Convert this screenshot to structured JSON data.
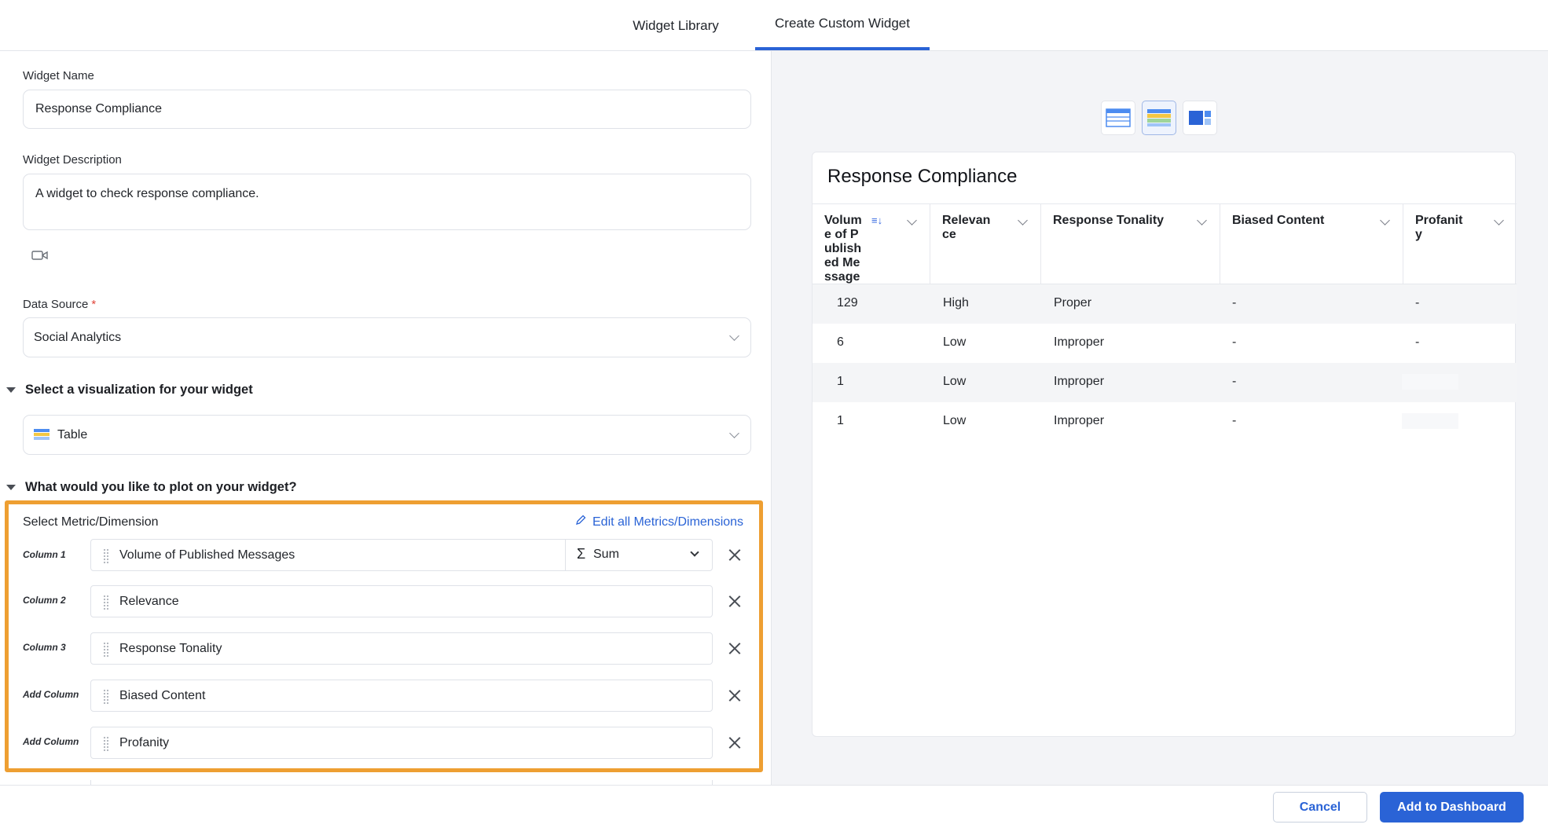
{
  "tabs": {
    "library": "Widget Library",
    "custom": "Create Custom Widget"
  },
  "form": {
    "name_label": "Widget Name",
    "name_value": "Response Compliance",
    "desc_label": "Widget Description",
    "desc_value": "A widget to check response compliance.",
    "source_label": "Data Source",
    "source_required": "*",
    "source_value": "Social Analytics",
    "viz_section": "Select a visualization for your widget",
    "viz_value": "Table",
    "plot_section": "What would you like to plot on your widget?"
  },
  "metrics": {
    "title": "Select Metric/Dimension",
    "edit_link": "Edit all Metrics/Dimensions",
    "rows": [
      {
        "label": "Column 1",
        "value": "Volume of Published Messages",
        "agg": "Sum",
        "agg_symbol": "Σ"
      },
      {
        "label": "Column 2",
        "value": "Relevance"
      },
      {
        "label": "Column 3",
        "value": "Response Tonality"
      },
      {
        "label": "Add Column",
        "value": "Biased Content"
      },
      {
        "label": "Add Column",
        "value": "Profanity"
      }
    ]
  },
  "preview": {
    "title": "Response Compliance",
    "headers": [
      "Volume of Published Messages",
      "Relevance",
      "Response Tonality",
      "Biased Content",
      "Profanity"
    ],
    "rows": [
      [
        "129",
        "High",
        "Proper",
        "-",
        "-"
      ],
      [
        "6",
        "Low",
        "Improper",
        "-",
        "-"
      ],
      [
        "1",
        "Low",
        "Improper",
        "-",
        ""
      ],
      [
        "1",
        "Low",
        "Improper",
        "-",
        ""
      ]
    ]
  },
  "buttons": {
    "cancel": "Cancel",
    "add": "Add to Dashboard"
  },
  "colors": {
    "accent": "#2a63d6",
    "highlight": "#ee9f32"
  }
}
